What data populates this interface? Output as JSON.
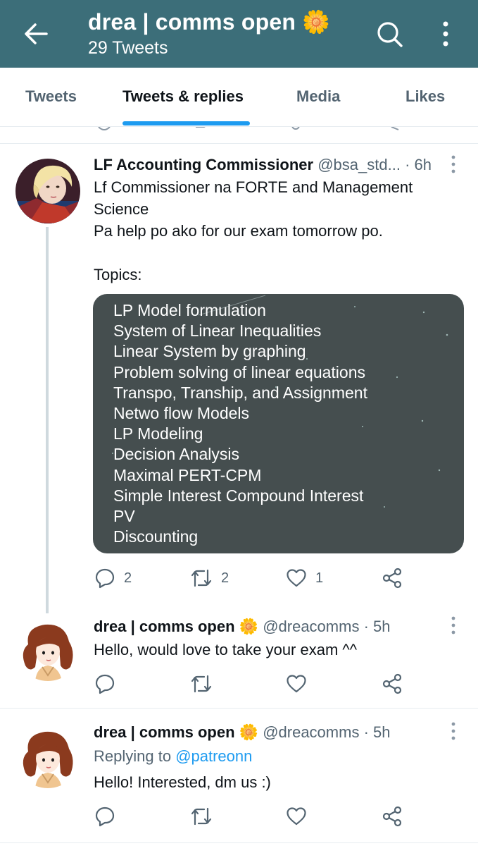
{
  "header": {
    "title": "drea | comms open 🌼",
    "subtitle": "29 Tweets"
  },
  "tabs": [
    {
      "label": "Tweets",
      "active": false
    },
    {
      "label": "Tweets & replies",
      "active": true
    },
    {
      "label": "Media",
      "active": false
    },
    {
      "label": "Likes",
      "active": false
    }
  ],
  "tweets": [
    {
      "name": "LF Accounting Commissioner",
      "handle": "@bsa_std...",
      "time": "· 6h",
      "lines": [
        "Lf Commissioner na FORTE and Management",
        "Science",
        "Pa help po ako for our exam tomorrow po.",
        "",
        "Topics:"
      ],
      "card_items": [
        "LP Model formulation",
        "System of Linear Inequalities",
        "Linear System by graphing",
        "Problem solving of linear equations",
        "Transpo, Tranship, and Assignment",
        "Netwo flow Models",
        "LP Modeling",
        "Decision Analysis",
        "Maximal PERT-CPM",
        "Simple Interest Compound Interest",
        "PV",
        "Discounting"
      ],
      "reply_count": "2",
      "retweet_count": "2",
      "like_count": "1"
    },
    {
      "name": "drea | comms open 🌼",
      "handle": "@dreacomms",
      "time": "· 5h",
      "text": "Hello, would love to take your exam ^^"
    },
    {
      "name": "drea | comms open 🌼",
      "handle": "@dreacomms",
      "time": "· 5h",
      "replying_prefix": "Replying to ",
      "replying_handle": "@patreonn",
      "text": "Hello! Interested, dm us :)"
    }
  ],
  "icons": {
    "back": "arrow-left-icon",
    "search": "search-icon",
    "more": "more-vertical-icon",
    "reply": "reply-icon",
    "retweet": "retweet-icon",
    "like": "heart-icon",
    "share": "share-icon"
  },
  "colors": {
    "header_bg": "#3c6e79",
    "accent": "#1d9bf0",
    "card_bg": "#454e4f"
  }
}
